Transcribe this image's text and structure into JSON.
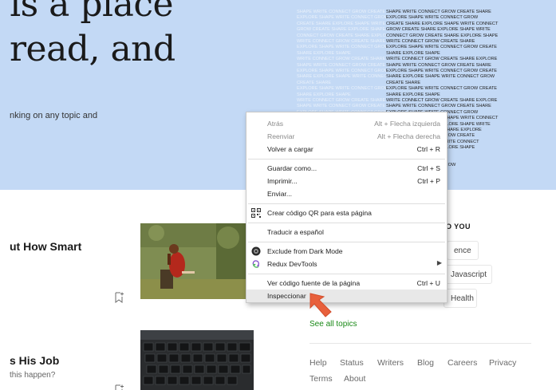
{
  "hero": {
    "title_line1": "is a place",
    "title_line2": "read, and",
    "subtitle": "nking on any topic and",
    "pattern_rows": [
      "SHAPE WRITE CONNECT GROW CREATE SHARE",
      "EXPLORE SHAPE WRITE CONNECT GROW",
      "CREATE SHARE EXPLORE SHAPE WRITE CONNECT",
      "GROW CREATE SHARE EXPLORE SHAPE WRITE",
      "CONNECT GROW CREATE SHARE EXPLORE SHAPE",
      "WRITE CONNECT GROW CREATE SHARE",
      "EXPLORE SHAPE WRITE CONNECT GROW CREATE",
      "SHARE EXPLORE SHAPE",
      "WRITE CONNECT GROW CREATE SHARE EXPLORE",
      "SHAPE WRITE CONNECT GROW CREATE SHARE",
      "EXPLORE SHAPE WRITE CONNECT GROW CREATE",
      "SHARE EXPLORE SHAPE WRITE CONNECT GROW",
      "CREATE SHARE",
      "EXPLORE SHAPE WRITE CONNECT GROW CREATE",
      "SHARE EXPLORE SHAPE",
      "WRITE CONNECT GROW CREATE SHARE EXPLORE",
      "SHAPE WRITE CONNECT GROW CREATE SHARE",
      "EXPLORE SHAPE WRITE CONNECT GROW",
      "CREATE SHARE EXPLORE SHAPE WRITE CONNECT",
      "GROW CREATE SHARE EXPLORE SHAPE WRITE",
      "CONNECT GROW CREATE SHARE EXPLORE",
      "SHAPE WRITE CONNECT GROW CREATE",
      "SHARE EXPLORE SHAPE WRITE CONNECT",
      "GROW CREATE SHARE EXPLORE SHAPE",
      "WRITE CONNECT GROW",
      "CREATE SHARE EXPLORE",
      "SHAPE WRITE CONNECT GROW",
      "CREATE SHARE",
      "EXPLORE SHAPE",
      "WRITE CREATE"
    ]
  },
  "articles": [
    {
      "title": "ut How Smart",
      "subtitle": ""
    },
    {
      "title": "s His Job",
      "subtitle": "this happen?"
    }
  ],
  "recommended": {
    "heading": "O YOU",
    "topics": [
      "ence",
      "Javascript",
      "Health"
    ],
    "see_all": "See all topics"
  },
  "footer": {
    "links": [
      "Help",
      "Status",
      "Writers",
      "Blog",
      "Careers",
      "Privacy",
      "Terms",
      "About"
    ]
  },
  "context_menu": {
    "items": [
      {
        "label": "Atrás",
        "shortcut": "Alt + Flecha izquierda"
      },
      {
        "label": "Reenviar",
        "shortcut": "Alt + Flecha derecha"
      },
      {
        "label": "Volver a cargar",
        "shortcut": "Ctrl + R"
      },
      {
        "label": "Guardar como...",
        "shortcut": "Ctrl + S"
      },
      {
        "label": "Imprimir...",
        "shortcut": "Ctrl + P"
      },
      {
        "label": "Enviar...",
        "shortcut": ""
      },
      {
        "label": "Crear código QR para esta página",
        "shortcut": "",
        "icon": "qr-code-icon"
      },
      {
        "label": "Traducir a español",
        "shortcut": ""
      },
      {
        "label": "Exclude from Dark Mode",
        "shortcut": "",
        "icon": "dark-mode-icon"
      },
      {
        "label": "Redux DevTools",
        "shortcut": "",
        "icon": "redux-icon",
        "submenu": true
      },
      {
        "label": "Ver código fuente de la página",
        "shortcut": "Ctrl + U"
      },
      {
        "label": "Inspeccionar",
        "shortcut": "",
        "highlighted": true
      }
    ]
  },
  "colors": {
    "hero_bg": "#c3d9f5",
    "accent_green": "#1a8917",
    "pointer_orange": "#e8603c",
    "menu_highlight": "#e8e8e8"
  }
}
